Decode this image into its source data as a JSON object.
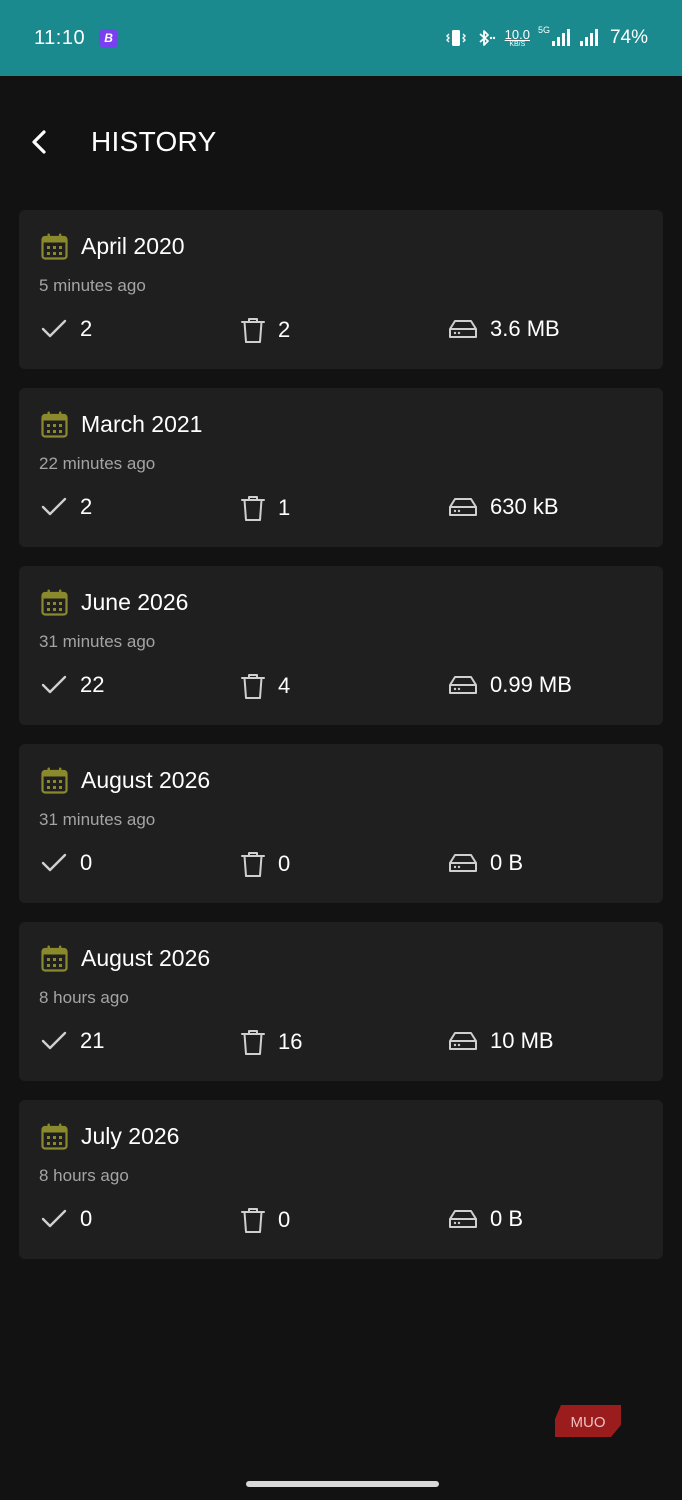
{
  "status_bar": {
    "time": "11:10",
    "app_badge": "B",
    "speed_value": "10.0",
    "speed_unit": "KB/S",
    "network": "5G",
    "battery": "74%",
    "icons": [
      "vibrate-icon",
      "bluetooth-icon",
      "signal-icon",
      "signal-icon"
    ]
  },
  "header": {
    "title": "HISTORY",
    "back_icon": "chevron-left-icon"
  },
  "history": [
    {
      "title": "April 2020",
      "time": "5 minutes ago",
      "kept": "2",
      "deleted": "2",
      "size": "3.6 MB"
    },
    {
      "title": "March 2021",
      "time": "22 minutes ago",
      "kept": "2",
      "deleted": "1",
      "size": "630 kB"
    },
    {
      "title": "June 2026",
      "time": "31 minutes ago",
      "kept": "22",
      "deleted": "4",
      "size": "0.99 MB"
    },
    {
      "title": "August 2026",
      "time": "31 minutes ago",
      "kept": "0",
      "deleted": "0",
      "size": "0 B"
    },
    {
      "title": "August 2026",
      "time": "8 hours ago",
      "kept": "21",
      "deleted": "16",
      "size": "10 MB"
    },
    {
      "title": "July 2026",
      "time": "8 hours ago",
      "kept": "0",
      "deleted": "0",
      "size": "0 B"
    }
  ],
  "watermark": "MUO",
  "colors": {
    "status_bar": "#1b8a8f",
    "background": "#121212",
    "card": "#1f1f1f",
    "calendar_accent": "#8a8a2c",
    "secondary_text": "#a4a4a4"
  }
}
